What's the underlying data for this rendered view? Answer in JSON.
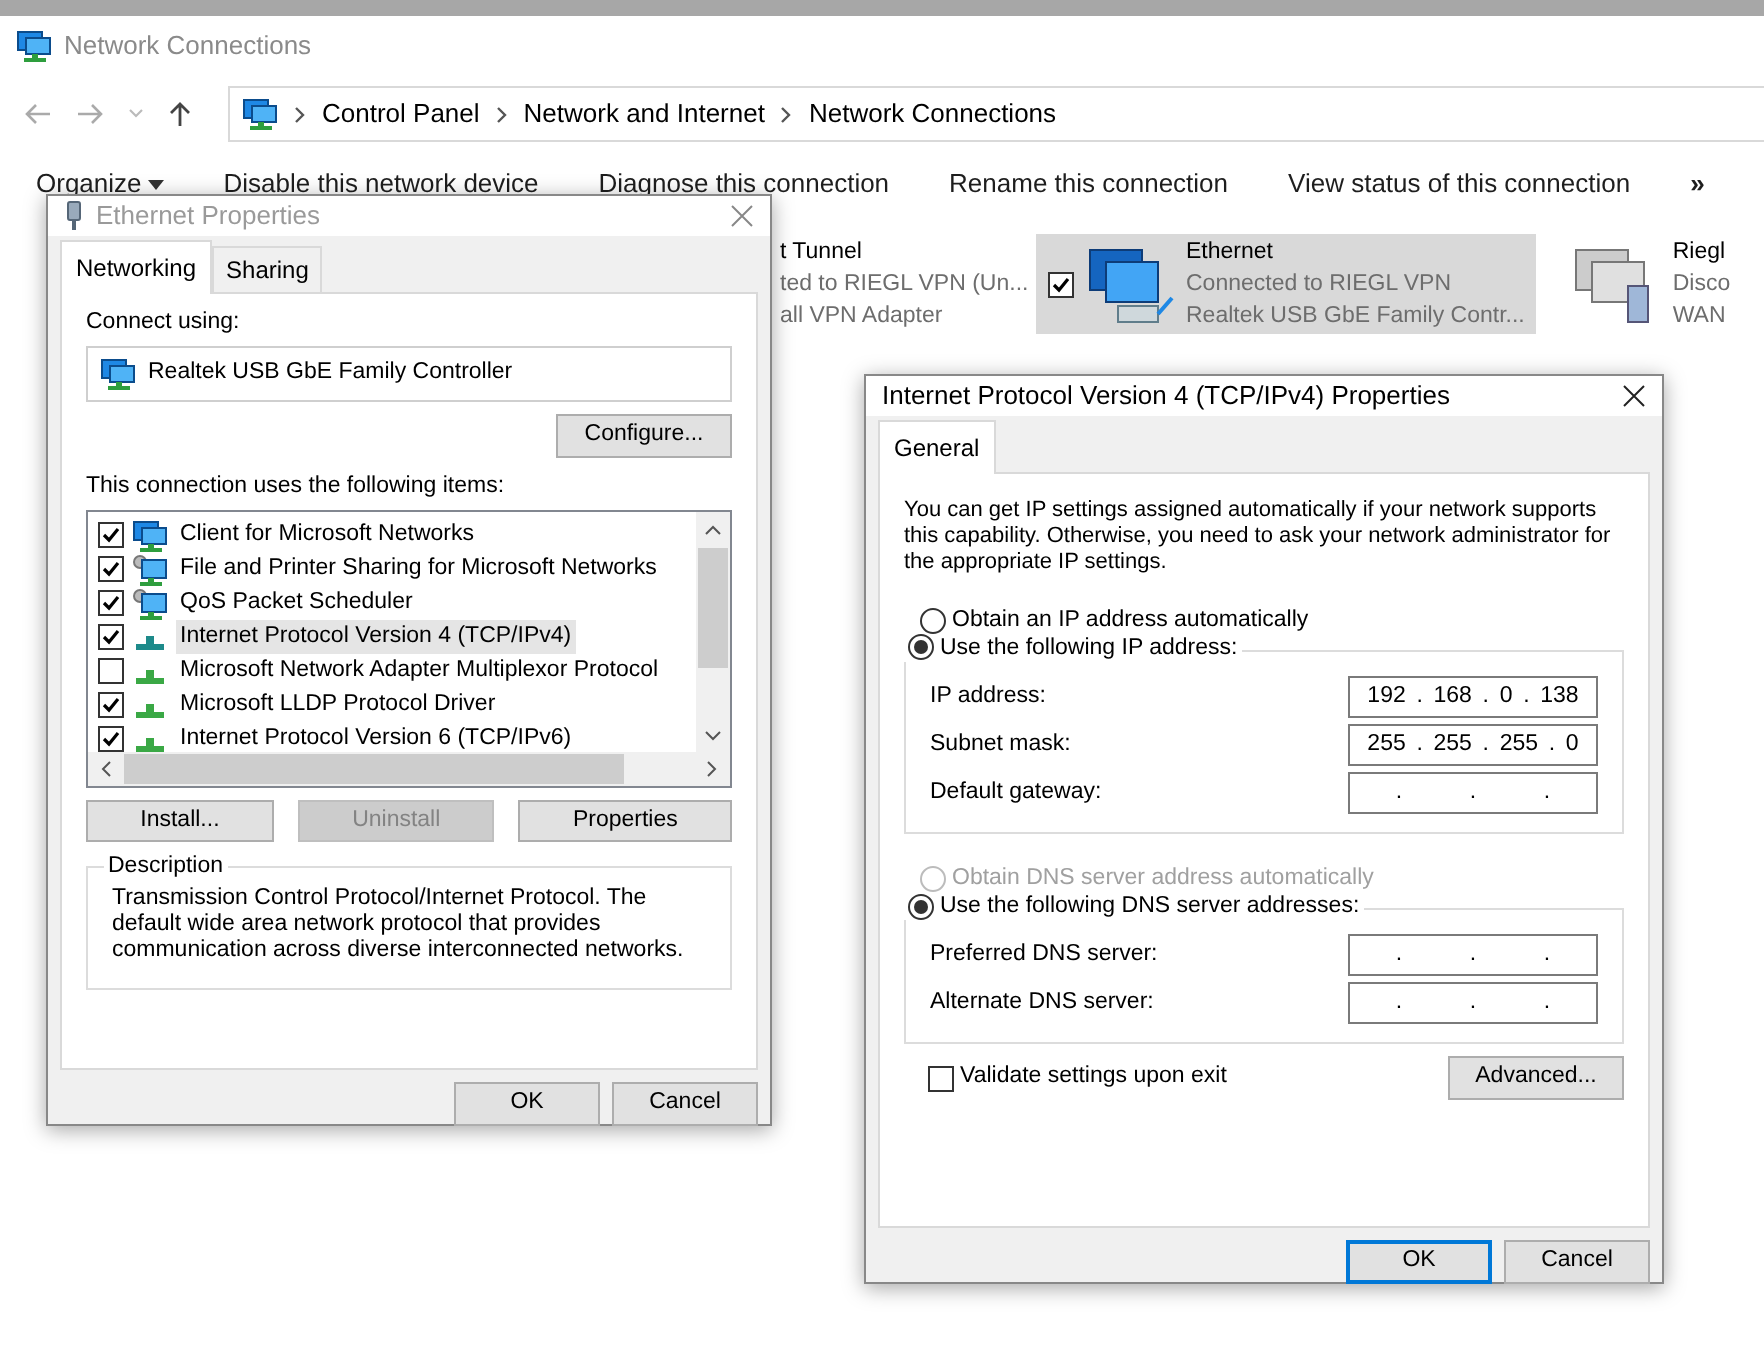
{
  "window": {
    "title": "Network Connections"
  },
  "address_bar": {
    "path": [
      "Control Panel",
      "Network and Internet",
      "Network Connections"
    ]
  },
  "command_bar": {
    "items": [
      "Organize",
      "Disable this network device",
      "Diagnose this connection",
      "Rename this connection",
      "View status of this connection"
    ],
    "overflow": "»"
  },
  "connections": [
    {
      "name": "t Tunnel",
      "status": "ted to RIEGL VPN (Un...",
      "device": "all VPN Adapter",
      "selected": false,
      "kind": "partial"
    },
    {
      "name": "Ethernet",
      "status": "Connected to RIEGL VPN",
      "device": "Realtek USB GbE Family Contr...",
      "selected": true,
      "kind": "ethernet"
    },
    {
      "name": "Riegl",
      "status": "Disco",
      "device": "WAN",
      "selected": false,
      "kind": "wan"
    }
  ],
  "ethernet_dialog": {
    "title": "Ethernet Properties",
    "tabs": [
      {
        "label": "Networking",
        "selected": true
      },
      {
        "label": "Sharing",
        "selected": false
      }
    ],
    "connect_using_label": "Connect using:",
    "adapter": "Realtek USB GbE Family Controller",
    "configure_button": "Configure...",
    "items_label": "This connection uses the following items:",
    "items": [
      {
        "label": "Client for Microsoft Networks",
        "checked": true,
        "selected": false,
        "kind": "client"
      },
      {
        "label": "File and Printer Sharing for Microsoft Networks",
        "checked": true,
        "selected": false,
        "kind": "service"
      },
      {
        "label": "QoS Packet Scheduler",
        "checked": true,
        "selected": false,
        "kind": "service"
      },
      {
        "label": "Internet Protocol Version 4 (TCP/IPv4)",
        "checked": true,
        "selected": true,
        "kind": "protocol"
      },
      {
        "label": "Microsoft Network Adapter Multiplexor Protocol",
        "checked": false,
        "selected": false,
        "kind": "protocol"
      },
      {
        "label": "Microsoft LLDP Protocol Driver",
        "checked": true,
        "selected": false,
        "kind": "protocol"
      },
      {
        "label": "Internet Protocol Version 6 (TCP/IPv6)",
        "checked": true,
        "selected": false,
        "kind": "protocol"
      }
    ],
    "buttons": [
      {
        "label": "Install...",
        "disabled": false
      },
      {
        "label": "Uninstall",
        "disabled": true
      },
      {
        "label": "Properties",
        "disabled": false
      }
    ],
    "description_title": "Description",
    "description": "Transmission Control Protocol/Internet Protocol. The default wide area network protocol that provides communication across diverse interconnected networks.",
    "ok": "OK",
    "cancel": "Cancel"
  },
  "ipv4_dialog": {
    "title": "Internet Protocol Version 4 (TCP/IPv4) Properties",
    "tabs": [
      {
        "label": "General",
        "selected": true
      }
    ],
    "intro": "You can get IP settings assigned automatically if your network supports this capability. Otherwise, you need to ask your network administrator for the appropriate IP settings.",
    "ip_options": [
      {
        "label": "Obtain an IP address automatically",
        "selected": false,
        "disabled": false
      },
      {
        "label": "Use the following IP address:",
        "selected": true,
        "disabled": false
      }
    ],
    "ip_fields": [
      {
        "label": "IP address:",
        "octets": [
          "192",
          ".",
          "168",
          ".",
          "0",
          ".",
          "138"
        ]
      },
      {
        "label": "Subnet mask:",
        "octets": [
          "255",
          ".",
          "255",
          ".",
          "255",
          ".",
          "0"
        ]
      },
      {
        "label": "Default gateway:",
        "octets": [
          ".",
          ".",
          "."
        ]
      }
    ],
    "dns_options": [
      {
        "label": "Obtain DNS server address automatically",
        "selected": false,
        "disabled": true
      },
      {
        "label": "Use the following DNS server addresses:",
        "selected": true,
        "disabled": false
      }
    ],
    "dns_fields": [
      {
        "label": "Preferred DNS server:",
        "octets": [
          ".",
          ".",
          "."
        ]
      },
      {
        "label": "Alternate DNS server:",
        "octets": [
          ".",
          ".",
          "."
        ]
      }
    ],
    "validate": {
      "label": "Validate settings upon exit",
      "checked": false
    },
    "advanced_button": "Advanced...",
    "ok": "OK",
    "cancel": "Cancel"
  }
}
